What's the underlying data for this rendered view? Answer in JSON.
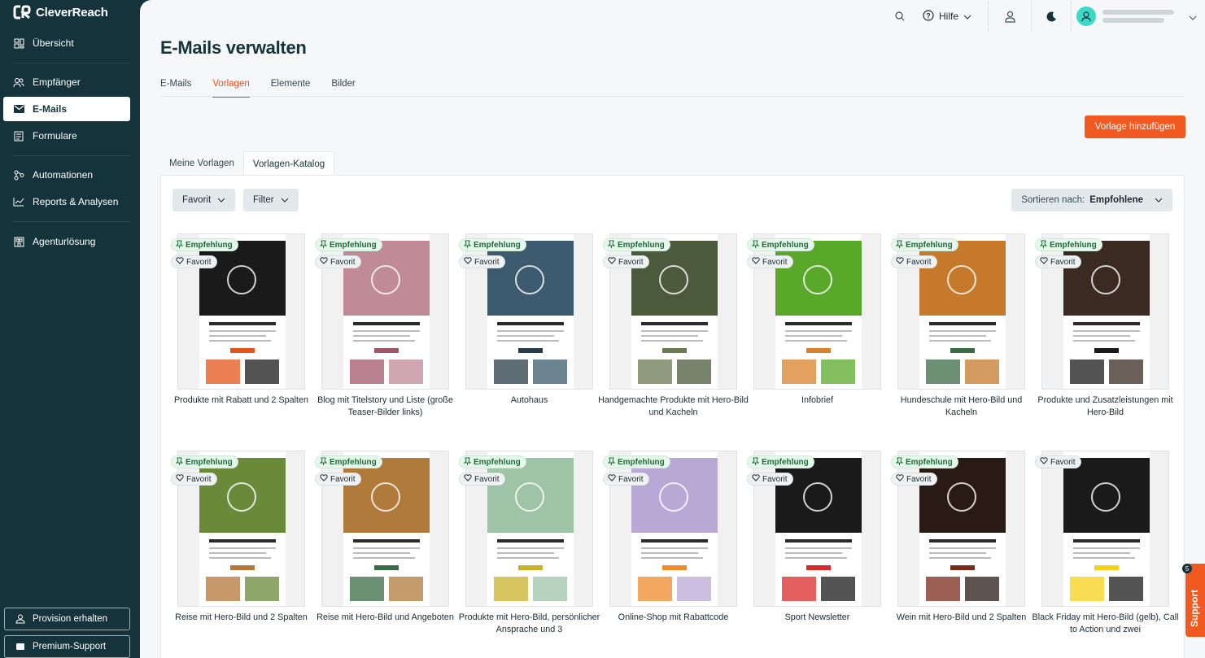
{
  "app": {
    "name": "CleverReach"
  },
  "sidebar": {
    "items": [
      {
        "label": "Übersicht",
        "icon": "dashboard-icon"
      },
      {
        "label": "Empfänger",
        "icon": "users-icon"
      },
      {
        "label": "E-Mails",
        "icon": "mail-icon",
        "active": true
      },
      {
        "label": "Formulare",
        "icon": "form-icon"
      },
      {
        "label": "Automationen",
        "icon": "automation-icon"
      },
      {
        "label": "Reports & Analysen",
        "icon": "chart-icon"
      },
      {
        "label": "Agenturlösung",
        "icon": "agency-icon"
      }
    ],
    "provision_label": "Provision erhalten",
    "support_label": "Premium-Support"
  },
  "topbar": {
    "help_label": "Hilfe"
  },
  "page": {
    "title": "E-Mails verwalten",
    "tabs": [
      "E-Mails",
      "Vorlagen",
      "Elemente",
      "Bilder"
    ],
    "active_tab": "Vorlagen",
    "add_button": "Vorlage hinzufügen",
    "subtabs": [
      "Meine Vorlagen",
      "Vorlagen-Katalog"
    ],
    "active_subtab": "Vorlagen-Katalog"
  },
  "filters": {
    "favorite_label": "Favorit",
    "filter_label": "Filter",
    "sort_prefix": "Sortieren nach:",
    "sort_value": "Empfohlene"
  },
  "badges": {
    "recommended": "Empfehlung",
    "favorite": "Favorit"
  },
  "templates": [
    {
      "title": "Produkte mit Rabatt und 2 Spalten",
      "recommended": true,
      "color": "#1a1a1a",
      "accent": "#e5531a"
    },
    {
      "title": "Blog mit Titelstory und Liste (große Teaser-Bilder links)",
      "recommended": true,
      "color": "#c08a96",
      "accent": "#a2566a"
    },
    {
      "title": "Autohaus",
      "recommended": true,
      "color": "#3c5b6e",
      "accent": "#2a3d48"
    },
    {
      "title": "Handgemachte Produkte mit Hero-Bild und Kacheln",
      "recommended": true,
      "color": "#4a5a3a",
      "accent": "#6b7a52"
    },
    {
      "title": "Infobrief",
      "recommended": true,
      "color": "#5aa82a",
      "accent": "#d9812a"
    },
    {
      "title": "Hundeschule mit Hero-Bild und Kacheln",
      "recommended": true,
      "color": "#c6792b",
      "accent": "#3b6b45"
    },
    {
      "title": "Produkte und Zusatzleistungen mit Hero-Bild",
      "recommended": true,
      "color": "#3a2a22",
      "accent": "#1a1a1a"
    },
    {
      "title": "Reise mit Hero-Bild und 2 Spalten",
      "recommended": true,
      "color": "#6a8a3a",
      "accent": "#b5763a"
    },
    {
      "title": "Reise mit Hero-Bild und Angeboten",
      "recommended": true,
      "color": "#b07a3a",
      "accent": "#3b6b45"
    },
    {
      "title": "Produkte mit Hero-Bild, persönlicher Ansprache und 3",
      "recommended": true,
      "color": "#9ec3a6",
      "accent": "#c9b32a"
    },
    {
      "title": "Online-Shop mit Rabattcode",
      "recommended": true,
      "color": "#b9a8d6",
      "accent": "#f08a2a"
    },
    {
      "title": "Sport Newsletter",
      "recommended": true,
      "color": "#1a1a1a",
      "accent": "#d92a2a"
    },
    {
      "title": "Wein mit Hero-Bild und 2 Spalten",
      "recommended": true,
      "color": "#2a1a14",
      "accent": "#7a2a1a"
    },
    {
      "title": "Black Friday mit Hero-Bild (gelb), Call to Action und zwei",
      "recommended": false,
      "color": "#1a1a1a",
      "accent": "#f5d21a"
    }
  ],
  "support_widget": {
    "label": "Support",
    "count": "5"
  }
}
